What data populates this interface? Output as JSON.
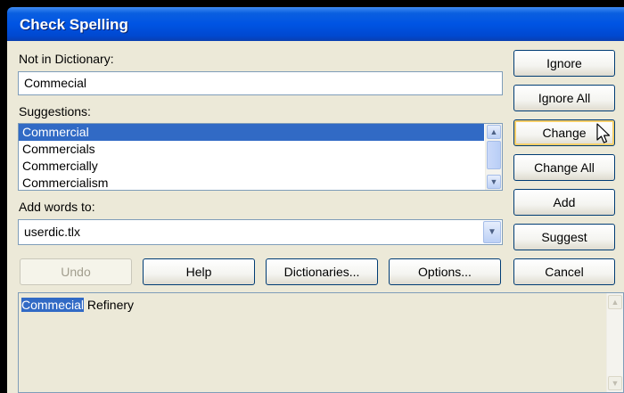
{
  "window": {
    "title": "Check Spelling"
  },
  "not_in_dictionary": {
    "label": "Not in Dictionary:",
    "value": "Commecial"
  },
  "suggestions": {
    "label": "Suggestions:",
    "items": [
      "Commercial",
      "Commercials",
      "Commercially",
      "Commercialism"
    ],
    "selected_index": 0
  },
  "add_words_to": {
    "label": "Add words to:",
    "value": "userdic.tlx"
  },
  "buttons": {
    "ignore": "Ignore",
    "ignore_all": "Ignore All",
    "change": "Change",
    "change_all": "Change All",
    "add": "Add",
    "suggest": "Suggest",
    "cancel": "Cancel",
    "undo": "Undo",
    "help": "Help",
    "dictionaries": "Dictionaries...",
    "options": "Options..."
  },
  "context": {
    "highlighted_word": "Commecial",
    "rest": " Refinery"
  },
  "icons": {
    "scroll_up": "▲",
    "scroll_down": "▼",
    "dropdown": "▼"
  }
}
